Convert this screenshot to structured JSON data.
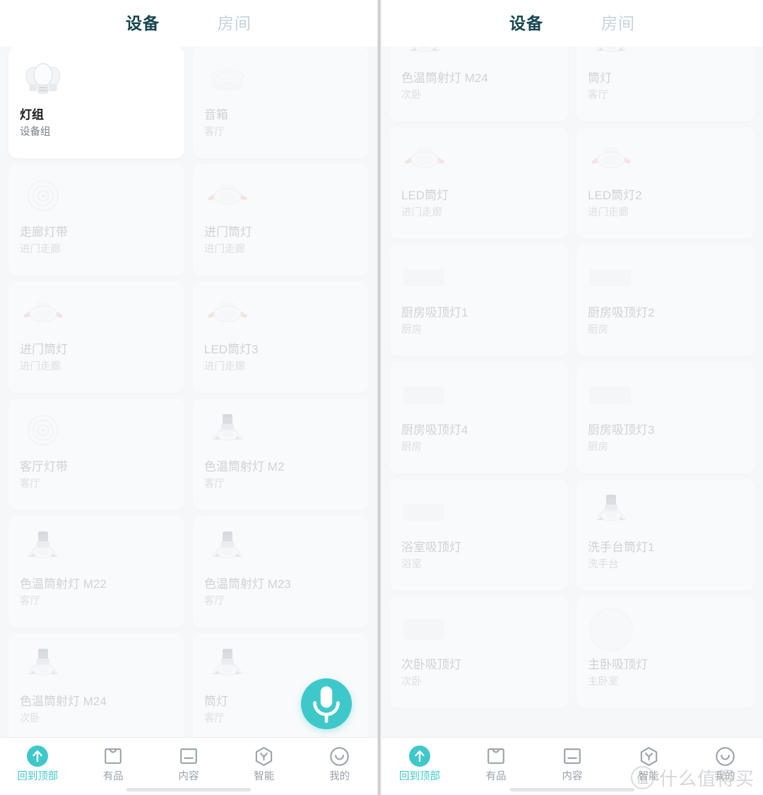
{
  "theme": {
    "accent": "#3fc8c9",
    "tab_active": "#16454f",
    "tab_inactive": "#c4d4d8",
    "card_bg": "#ffffff",
    "page_bg": "#f6f7f9",
    "text_muted": "#9aa0a6"
  },
  "left_panel": {
    "tabs": [
      {
        "label": "设备",
        "active": true
      },
      {
        "label": "房间",
        "active": false
      }
    ],
    "devices": [
      {
        "name": "灯组",
        "room": "设备组",
        "icon": "bulb-group",
        "active": true,
        "partial_top": false
      },
      {
        "name": "音箱",
        "room": "客厅",
        "icon": "speaker",
        "active": false,
        "partial_top": false
      },
      {
        "name": "走廊灯带",
        "room": "进门走廊",
        "icon": "light-strip",
        "active": false,
        "partial_top": false
      },
      {
        "name": "进门筒灯",
        "room": "进门走廊",
        "icon": "downlight-wing",
        "active": false,
        "partial_top": false
      },
      {
        "name": "进门筒灯",
        "room": "进门走廊",
        "icon": "downlight-wing",
        "active": false,
        "partial_top": false
      },
      {
        "name": "LED筒灯3",
        "room": "进门走廊",
        "icon": "downlight-wing",
        "active": false,
        "partial_top": false
      },
      {
        "name": "客厅灯带",
        "room": "客厅",
        "icon": "light-strip",
        "active": false,
        "partial_top": false
      },
      {
        "name": "色温筒射灯 M2",
        "room": "客厅",
        "icon": "spotlight",
        "active": false,
        "partial_top": false
      },
      {
        "name": "色温筒射灯 M22",
        "room": "客厅",
        "icon": "spotlight",
        "active": false,
        "partial_top": false
      },
      {
        "name": "色温筒射灯 M23",
        "room": "客厅",
        "icon": "spotlight",
        "active": false,
        "partial_top": false
      },
      {
        "name": "色温筒射灯 M24",
        "room": "次卧",
        "icon": "spotlight",
        "active": false,
        "partial_top": false
      },
      {
        "name": "筒灯",
        "room": "客厅",
        "icon": "spotlight",
        "active": false,
        "partial_top": false
      }
    ],
    "fab": {
      "icon": "microphone-icon",
      "label": "语音助手"
    },
    "bottom_nav": [
      {
        "label": "回到顶部",
        "icon": "arrow-up-circle-icon",
        "selected": true
      },
      {
        "label": "有品",
        "icon": "shopping-bag-icon",
        "selected": false
      },
      {
        "label": "内容",
        "icon": "content-square-icon",
        "selected": false
      },
      {
        "label": "智能",
        "icon": "hexagon-y-icon",
        "selected": false
      },
      {
        "label": "我的",
        "icon": "smiley-face-icon",
        "selected": false
      }
    ]
  },
  "right_panel": {
    "tabs": [
      {
        "label": "设备",
        "active": true
      },
      {
        "label": "房间",
        "active": false
      }
    ],
    "devices": [
      {
        "name": "色温筒射灯 M24",
        "room": "次卧",
        "icon": "spotlight",
        "active": false,
        "partial_top": true
      },
      {
        "name": "筒灯",
        "room": "客厅",
        "icon": "spotlight",
        "active": false,
        "partial_top": true
      },
      {
        "name": "LED筒灯",
        "room": "进门走廊",
        "icon": "downlight-wing",
        "active": false,
        "partial_top": false
      },
      {
        "name": "LED筒灯2",
        "room": "进门走廊",
        "icon": "downlight-wing",
        "active": false,
        "partial_top": false
      },
      {
        "name": "厨房吸顶灯1",
        "room": "厨房",
        "icon": "ceiling-rect",
        "active": false,
        "partial_top": false
      },
      {
        "name": "厨房吸顶灯2",
        "room": "厨房",
        "icon": "ceiling-rect",
        "active": false,
        "partial_top": false
      },
      {
        "name": "厨房吸顶灯4",
        "room": "厨房",
        "icon": "ceiling-rect",
        "active": false,
        "partial_top": false
      },
      {
        "name": "厨房吸顶灯3",
        "room": "厨房",
        "icon": "ceiling-rect",
        "active": false,
        "partial_top": false
      },
      {
        "name": "浴室吸顶灯",
        "room": "浴室",
        "icon": "ceiling-rect",
        "active": false,
        "partial_top": false
      },
      {
        "name": "洗手台筒灯1",
        "room": "洗手台",
        "icon": "spotlight",
        "active": false,
        "partial_top": false
      },
      {
        "name": "次卧吸顶灯",
        "room": "次卧",
        "icon": "ceiling-round-rect",
        "active": false,
        "partial_top": false
      },
      {
        "name": "主卧吸顶灯",
        "room": "主卧室",
        "icon": "ceiling-circle",
        "active": false,
        "partial_top": false
      }
    ],
    "bottom_nav": [
      {
        "label": "回到顶部",
        "icon": "arrow-up-circle-icon",
        "selected": true
      },
      {
        "label": "有品",
        "icon": "shopping-bag-icon",
        "selected": false
      },
      {
        "label": "内容",
        "icon": "content-square-icon",
        "selected": false
      },
      {
        "label": "智能",
        "icon": "hexagon-y-icon",
        "selected": false
      },
      {
        "label": "我的",
        "icon": "smiley-face-icon",
        "selected": false
      }
    ]
  },
  "watermark": {
    "badge": "值",
    "text": "什么值得买"
  }
}
